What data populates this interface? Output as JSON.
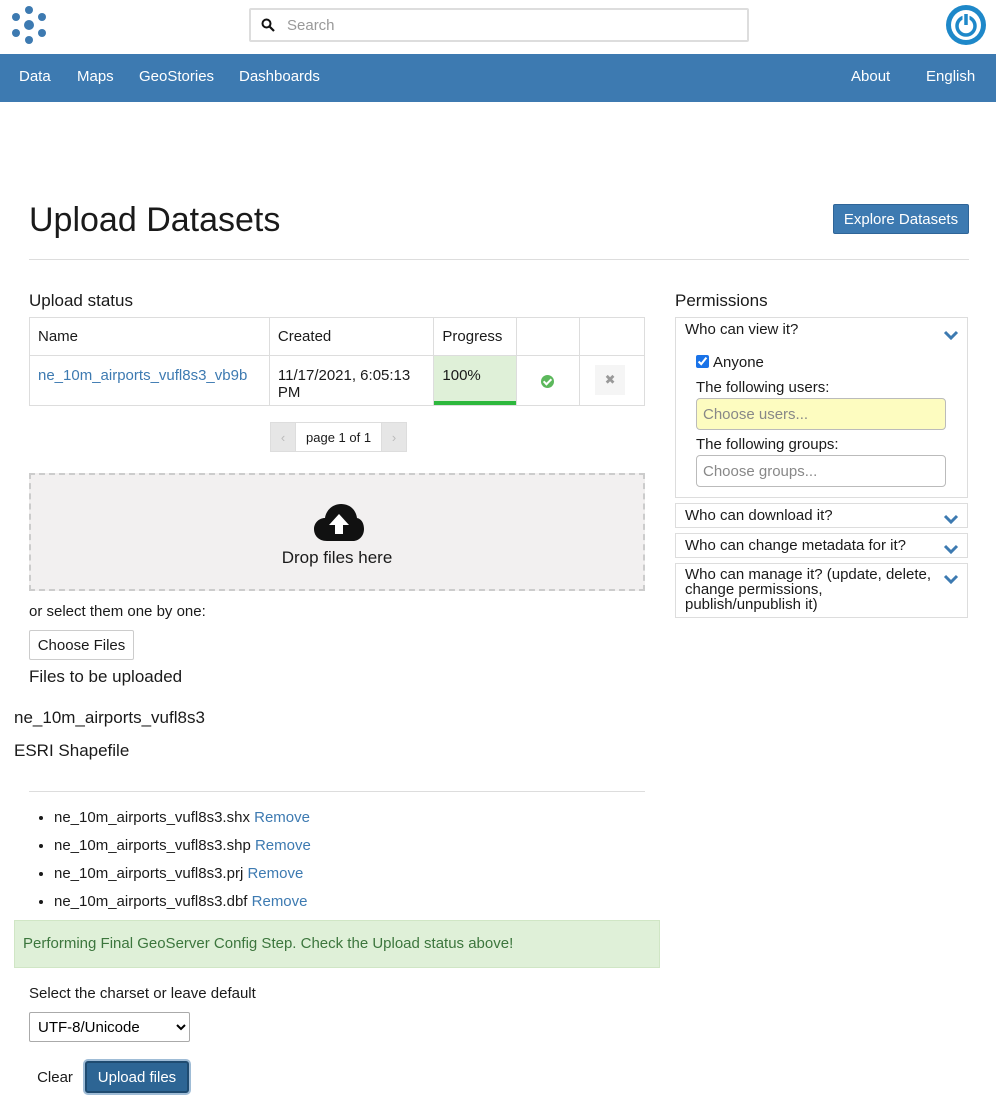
{
  "header": {
    "search_placeholder": "Search"
  },
  "nav": {
    "left": [
      "Data",
      "Maps",
      "GeoStories",
      "Dashboards"
    ],
    "right": [
      "About",
      "English"
    ]
  },
  "page": {
    "title": "Upload Datasets",
    "explore_button": "Explore Datasets"
  },
  "upload_status": {
    "heading": "Upload status",
    "columns": [
      "Name",
      "Created",
      "Progress",
      "",
      ""
    ],
    "rows": [
      {
        "name": "ne_10m_airports_vufl8s3_vb9b",
        "created": "11/17/2021, 6:05:13 PM",
        "progress": "100%",
        "progress_value": 1.0
      }
    ],
    "pager": {
      "prev": "‹",
      "label": "page 1 of 1",
      "next": "›"
    }
  },
  "dropzone": {
    "text": "Drop files here"
  },
  "files": {
    "or_select": "or select them one by one:",
    "choose_button": "Choose Files",
    "to_be_uploaded": "Files to be uploaded",
    "dataset_name": "ne_10m_airports_vufl8s3",
    "dataset_type": "ESRI Shapefile",
    "list": [
      {
        "name": "ne_10m_airports_vufl8s3.shx",
        "action": "Remove"
      },
      {
        "name": "ne_10m_airports_vufl8s3.shp",
        "action": "Remove"
      },
      {
        "name": "ne_10m_airports_vufl8s3.prj",
        "action": "Remove"
      },
      {
        "name": "ne_10m_airports_vufl8s3.dbf",
        "action": "Remove"
      }
    ]
  },
  "alert": {
    "text": "Performing Final GeoServer Config Step. Check the Upload status above!"
  },
  "charset": {
    "label": "Select the charset or leave default",
    "selected": "UTF-8/Unicode"
  },
  "actions": {
    "clear": "Clear",
    "upload": "Upload files"
  },
  "permissions": {
    "heading": "Permissions",
    "view": {
      "title": "Who can view it?",
      "anyone_label": "Anyone",
      "anyone_checked": true,
      "users_label": "The following users:",
      "users_placeholder": "Choose users...",
      "groups_label": "The following groups:",
      "groups_placeholder": "Choose groups..."
    },
    "download_title": "Who can download it?",
    "metadata_title": "Who can change metadata for it?",
    "manage_title_lines": [
      "Who can manage it? (update, delete,",
      "change permissions,",
      "publish/unpublish it)"
    ]
  },
  "colors": {
    "brand": "#3d7ab1",
    "success": "#2db83d",
    "alert_bg": "#dff0d8",
    "alert_text": "#3c763d"
  },
  "icons": [
    "geonode-logo-icon",
    "search-icon",
    "power-icon",
    "check-circle-icon",
    "close-icon",
    "cloud-upload-icon",
    "chevron-down-icon"
  ]
}
